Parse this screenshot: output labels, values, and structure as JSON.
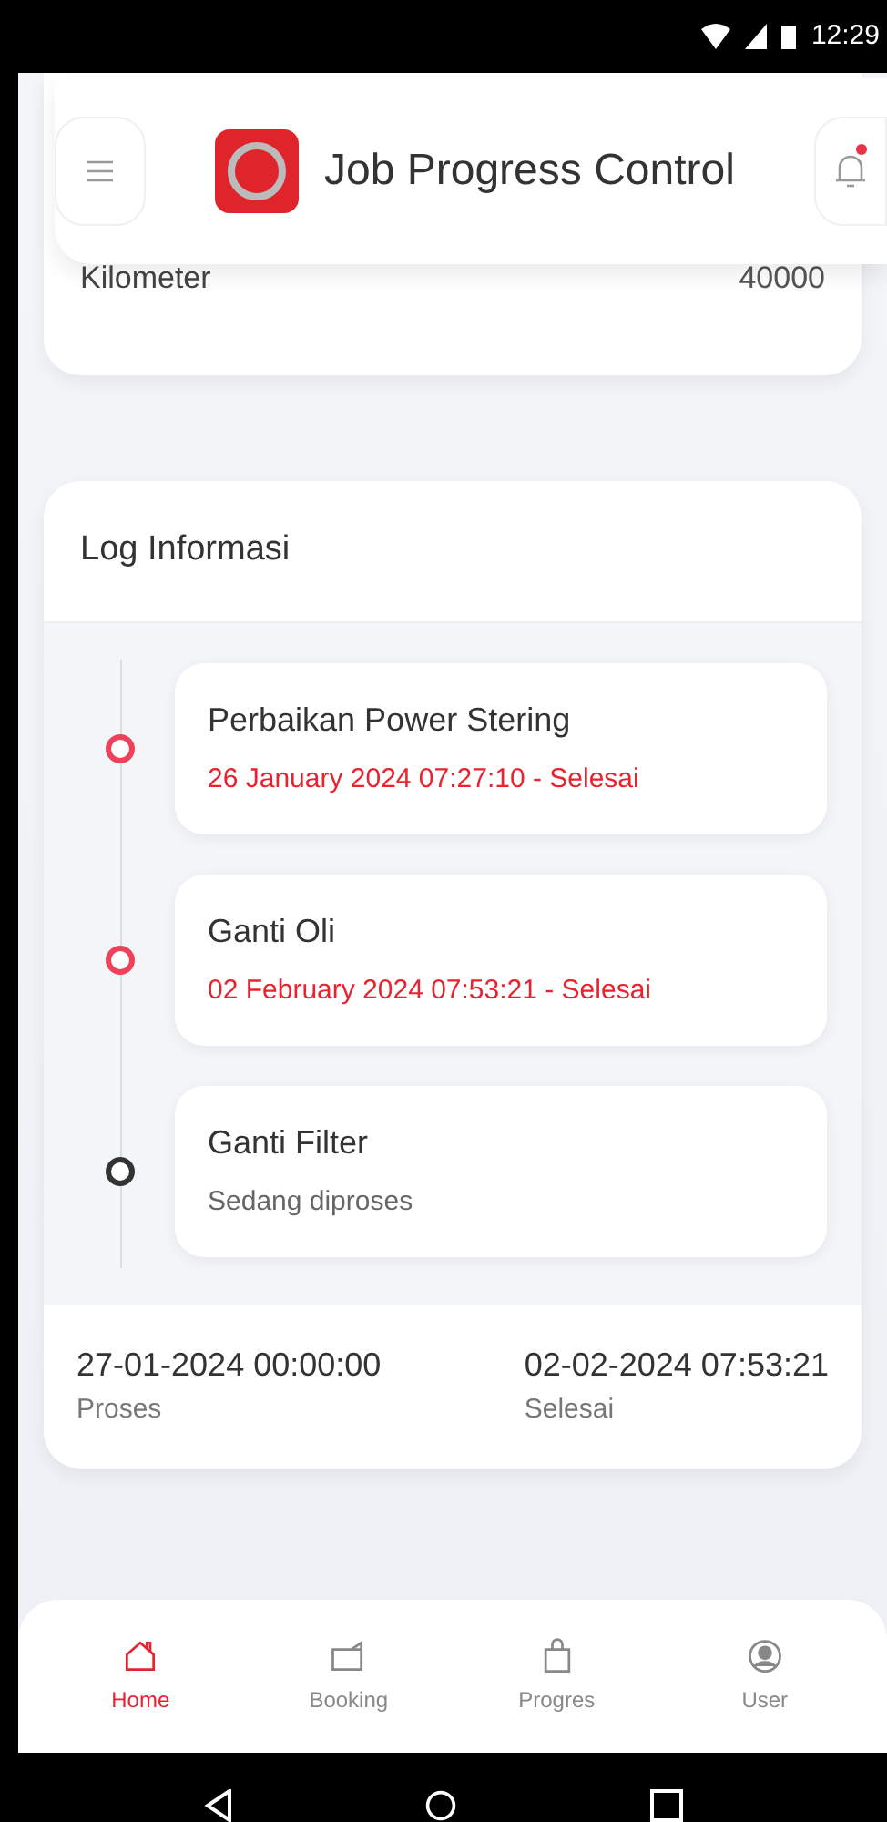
{
  "status_bar": {
    "time": "12:29"
  },
  "header": {
    "title": "Job Progress Control",
    "notification": true
  },
  "vehicle": {
    "rows": [
      {
        "label": "Kilometer",
        "value": "40000"
      }
    ]
  },
  "log": {
    "title": "Log Informasi",
    "items": [
      {
        "title": "Perbaikan Power Stering",
        "status": "26 January 2024 07:27:10 - Selesai",
        "done": true
      },
      {
        "title": "Ganti Oli",
        "status": "02 February 2024 07:53:21 - Selesai",
        "done": true
      },
      {
        "title": "Ganti Filter",
        "status": "Sedang diproses",
        "done": false
      }
    ],
    "summary": [
      {
        "value": "27-01-2024 00:00:00",
        "label": "Proses"
      },
      {
        "value": "02-02-2024 07:53:21",
        "label": "Selesai"
      }
    ]
  },
  "nav": [
    {
      "label": "Home",
      "kind": "home",
      "selected": true
    },
    {
      "label": "Booking",
      "kind": "folder",
      "selected": false
    },
    {
      "label": "Progres",
      "kind": "bag",
      "selected": false
    },
    {
      "label": "User",
      "kind": "user",
      "selected": false
    }
  ]
}
